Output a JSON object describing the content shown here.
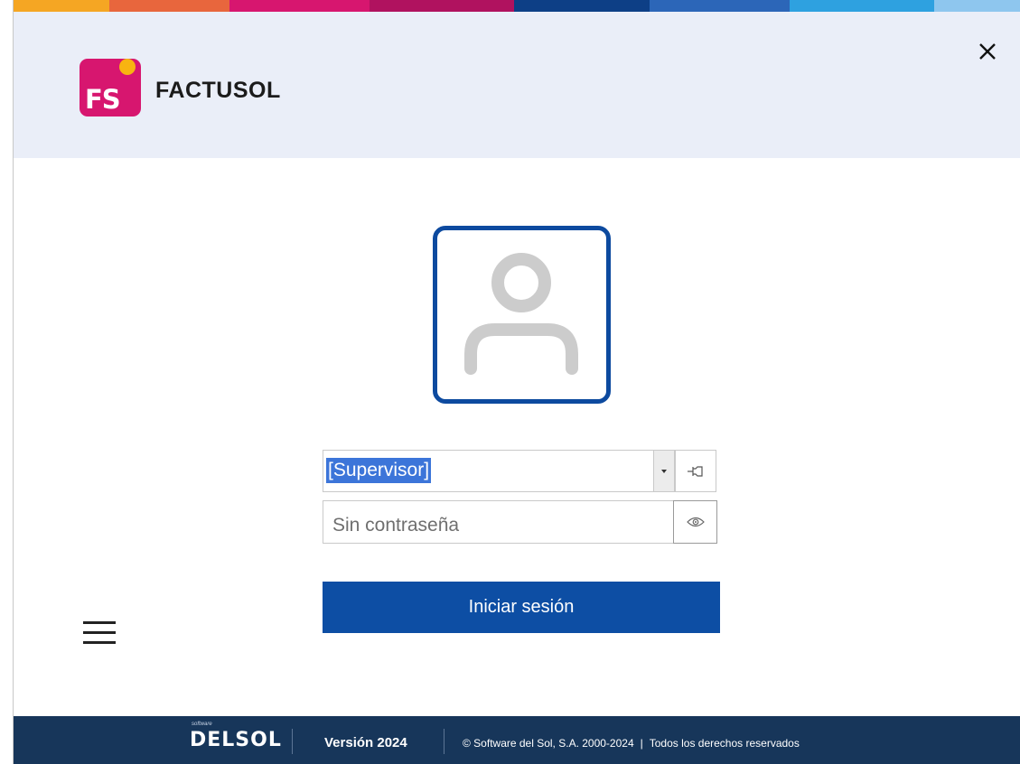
{
  "app": {
    "name": "FACTUSOL",
    "logo_text": "FS"
  },
  "colors": {
    "brand_magenta": "#d7166f",
    "brand_yellow": "#f8b411",
    "primary_blue": "#0d4ea4",
    "footer_navy": "#17365a",
    "header_bg": "#eaeef8",
    "top_stripe": [
      "#f5a623",
      "#e8663d",
      "#d7166f",
      "#b0125f",
      "#0d3f86",
      "#2c66b8",
      "#1e7fc9",
      "#2ea1e0",
      "#8ec6ee"
    ]
  },
  "header": {
    "close_icon": "close-icon"
  },
  "login": {
    "avatar_icon": "user-avatar-icon",
    "user_value": "[Supervisor]",
    "password_placeholder": "Sin contraseña",
    "password_value": "",
    "dropdown_icon": "caret-down-icon",
    "pin_icon": "pin-icon",
    "eye_icon": "eye-icon",
    "submit_label": "Iniciar sesión"
  },
  "menu": {
    "icon": "hamburger-icon"
  },
  "footer": {
    "brand_small": "software",
    "brand": "DELSOL",
    "version": "Versión 2024",
    "copyright": "© Software del Sol, S.A. 2000-2024",
    "rights": "Todos los derechos reservados"
  }
}
